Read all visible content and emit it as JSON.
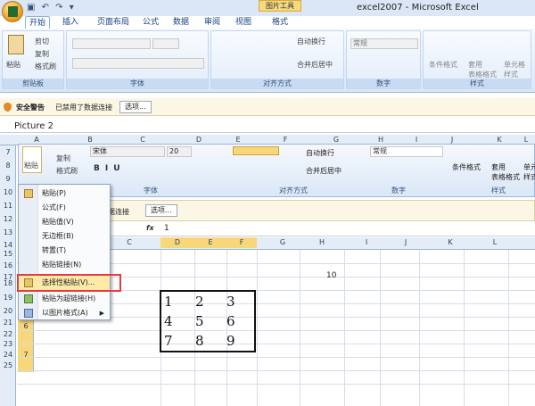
{
  "window": {
    "title": "excel2007 - Microsoft Excel",
    "context_tab": "图片工具"
  },
  "tabs": [
    "开始",
    "插入",
    "页面布局",
    "公式",
    "数据",
    "审阅",
    "视图",
    "格式"
  ],
  "ribbon1": {
    "paste": "粘贴",
    "cut": "剪切",
    "copy": "复制",
    "format_painter": "格式刷",
    "clipboard": "剪贴板",
    "font": "字体",
    "alignment": "对齐方式",
    "number": "数字",
    "styles": "样式",
    "autowrap": "自动换行",
    "merge": "合并后居中",
    "general": "常规",
    "cond_format": "条件格式",
    "table_format": "套用\n表格格式",
    "cell_style": "单元格\n样式"
  },
  "security": {
    "label": "安全警告",
    "message": "已禁用了数据连接",
    "options": "选项..."
  },
  "namebox": "Picture 2",
  "ribbon2": {
    "font_name": "宋体",
    "font_size": "20",
    "paste": "粘贴",
    "copy": "复制",
    "format_painter": "格式刷",
    "font": "字体",
    "alignment": "对齐方式",
    "number": "数字",
    "styles": "样式",
    "autowrap": "自动换行",
    "merge": "合并后居中",
    "general": "常规",
    "cond_format": "条件格式",
    "table_format": "套用\n表格格式",
    "cell_style": "单元\n样式"
  },
  "row_headers_2": [
    "7",
    "8",
    "9",
    "10",
    "11",
    "12",
    "13",
    "14",
    "15",
    "16",
    "17",
    "18",
    "19",
    "20",
    "21",
    "22",
    "23",
    "24",
    "25"
  ],
  "inner_rows": [
    "6",
    "7"
  ],
  "secbar2": {
    "message": "据连接",
    "options": "选项..."
  },
  "formula2": {
    "fx": "fx",
    "value": "1"
  },
  "columns": [
    "A",
    "B",
    "C",
    "D",
    "E",
    "F",
    "G",
    "H",
    "I",
    "J",
    "K",
    "L"
  ],
  "columns2": [
    "C",
    "D",
    "E",
    "F",
    "G",
    "H",
    "I",
    "J",
    "K",
    "L"
  ],
  "cell_h19": "10",
  "grid_values": [
    "1",
    "2",
    "3",
    "4",
    "5",
    "6",
    "7",
    "8",
    "9"
  ],
  "menu": [
    {
      "label": "粘贴(P)"
    },
    {
      "label": "公式(F)"
    },
    {
      "label": "粘贴值(V)"
    },
    {
      "label": "无边框(B)"
    },
    {
      "label": "转置(T)"
    },
    {
      "label": "粘贴链接(N)"
    },
    {
      "label": "选择性粘贴(V)..."
    },
    {
      "label": "粘贴为超链接(H)"
    },
    {
      "label": "以图片格式(A)"
    }
  ]
}
